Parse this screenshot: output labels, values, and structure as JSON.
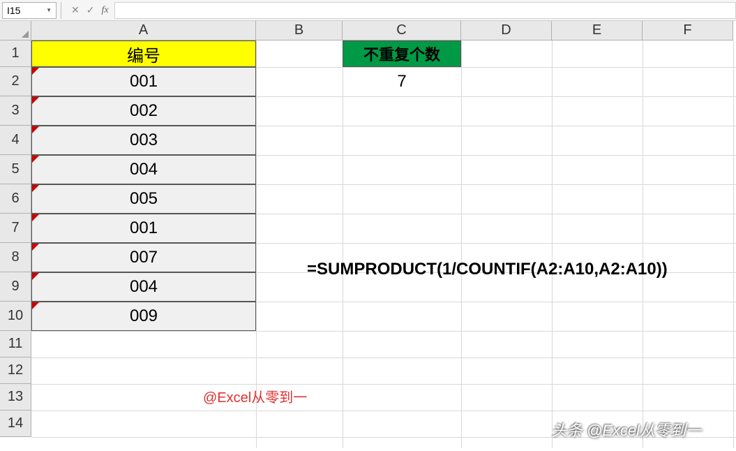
{
  "formula_bar": {
    "cell_ref": "I15",
    "formula_value": ""
  },
  "columns": [
    "A",
    "B",
    "C",
    "D",
    "E",
    "F"
  ],
  "rows": [
    "1",
    "2",
    "3",
    "4",
    "5",
    "6",
    "7",
    "8",
    "9",
    "10",
    "11",
    "12",
    "13",
    "14"
  ],
  "cells": {
    "A1": "编号",
    "A2": "001",
    "A3": "002",
    "A4": "003",
    "A5": "004",
    "A6": "005",
    "A7": "001",
    "A8": "007",
    "A9": "004",
    "A10": "009",
    "C1": "不重复个数",
    "C2": "7"
  },
  "formula_display": "=SUMPRODUCT(1/COUNTIF(A2:A10,A2:A10))",
  "watermark_red": "@Excel从零到一",
  "watermark_bottom": "头条 @Excel从零到一",
  "colors": {
    "header_yellow": "#ffff00",
    "header_green": "#009945",
    "comment_red": "#d00000"
  }
}
